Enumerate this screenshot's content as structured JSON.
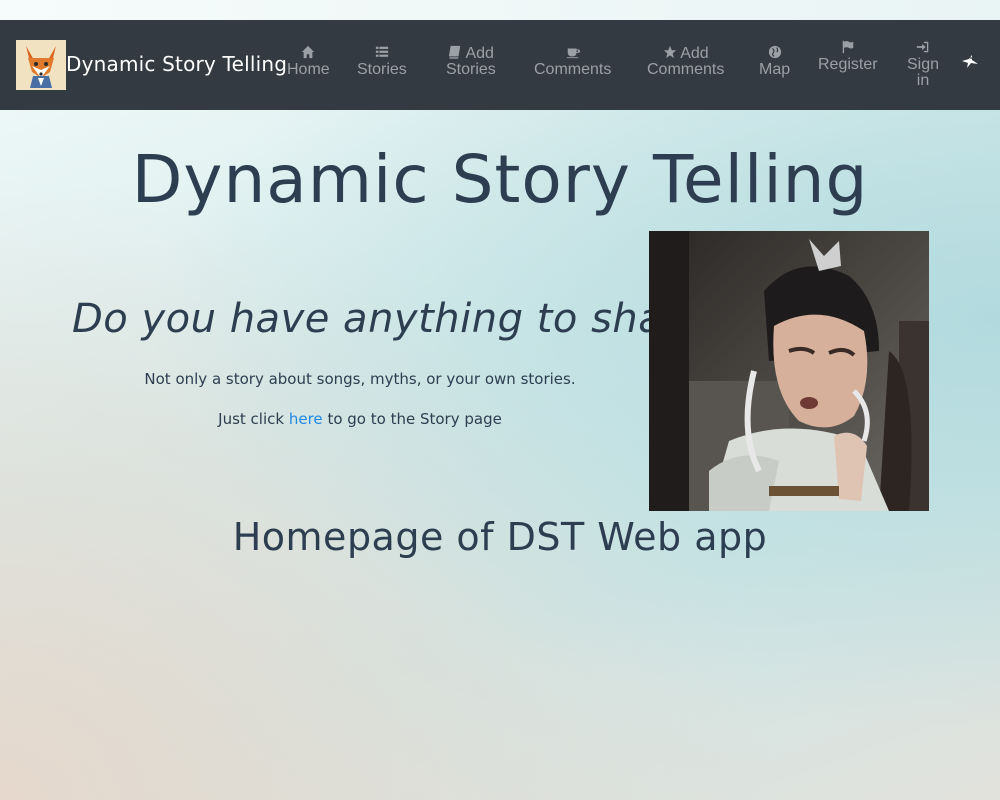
{
  "brand": {
    "logo_icon": "fox-icon",
    "title": "Dynamic Story Telling"
  },
  "nav": {
    "items": [
      {
        "icon": "home-icon",
        "line1": "Home",
        "line2": ""
      },
      {
        "icon": "list-icon",
        "line1": "Stories",
        "line2": ""
      },
      {
        "icon": "book-icon",
        "line1": "Add",
        "line2": "Stories"
      },
      {
        "icon": "coffee-icon",
        "line1": "",
        "line2": "Comments"
      },
      {
        "icon": "star-icon",
        "line1": "Add",
        "line2": "Comments"
      },
      {
        "icon": "globe-icon",
        "line1": "",
        "line2": "Map"
      },
      {
        "icon": "flag-icon",
        "line1": "",
        "line2": "Register"
      },
      {
        "icon": "sign-in-icon",
        "line1": "",
        "line2": "Sign",
        "line3": "in"
      }
    ],
    "corner_icon": "bird-icon"
  },
  "main": {
    "title": "Dynamic Story Telling",
    "share_heading": "Do you have anything to share ?",
    "subtitle": "Not only a story about songs, myths, or your own stories.",
    "cta_prefix": "Just click",
    "cta_link": "here",
    "cta_suffix": "to go to the Story page",
    "homepage_heading": "Homepage of DST Web app"
  },
  "colors": {
    "navbar": "#343a42",
    "nav_text": "#9aa0a6",
    "heading": "#2c3e50",
    "link": "#1e88e5"
  }
}
